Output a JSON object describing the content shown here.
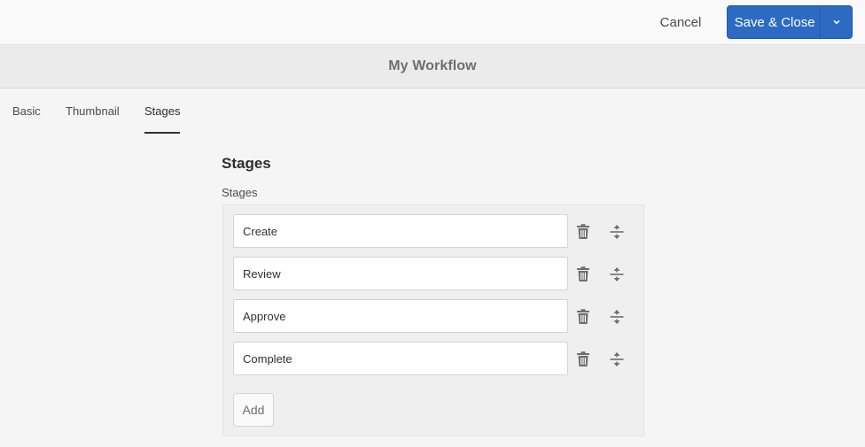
{
  "header": {
    "cancel_label": "Cancel",
    "save_label": "Save & Close",
    "accent_color": "#2d6ac4"
  },
  "title": "My Workflow",
  "tabs": [
    {
      "label": "Basic",
      "active": false
    },
    {
      "label": "Thumbnail",
      "active": false
    },
    {
      "label": "Stages",
      "active": true
    }
  ],
  "section": {
    "title": "Stages",
    "field_label": "Stages",
    "stages": [
      {
        "value": "Create"
      },
      {
        "value": "Review"
      },
      {
        "value": "Approve"
      },
      {
        "value": "Complete"
      }
    ],
    "add_label": "Add",
    "row_icons": [
      "trash-icon",
      "reorder-icon"
    ]
  }
}
